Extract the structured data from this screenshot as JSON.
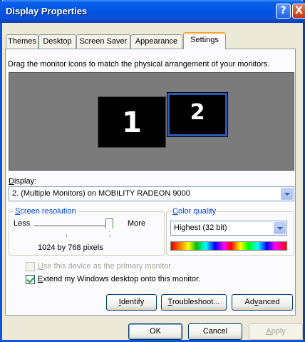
{
  "window": {
    "title": "Display Properties"
  },
  "titlebar": {
    "help_glyph": "?",
    "close_glyph": "X"
  },
  "tabs": [
    {
      "label": "Themes"
    },
    {
      "label": "Desktop"
    },
    {
      "label": "Screen Saver"
    },
    {
      "label": "Appearance"
    },
    {
      "label": "Settings"
    }
  ],
  "active_tab": "Settings",
  "settings": {
    "instruction": "Drag the monitor icons to match the physical arrangement of your monitors.",
    "monitors": [
      {
        "number": "1"
      },
      {
        "number": "2"
      }
    ],
    "display_label_pre": "",
    "display_label_ul": "D",
    "display_label_post": "isplay:",
    "display_value": "2. (Multiple Monitors) on MOBILITY RADEON 9000",
    "resolution": {
      "title_ul": "S",
      "title_post": "creen resolution",
      "less": "Less",
      "more": "More",
      "value": "1024 by 768 pixels",
      "slider_level": 1.0
    },
    "color_quality": {
      "title_ul": "C",
      "title_post": "olor quality",
      "value": "Highest (32 bit)"
    },
    "primary_checkbox": {
      "label_ul": "U",
      "label_post": "se this device as the primary monitor.",
      "checked": false,
      "enabled": false
    },
    "extend_checkbox": {
      "label_ul": "E",
      "label_post": "xtend my Windows desktop onto this monitor.",
      "checked": true,
      "enabled": true
    },
    "buttons": {
      "identify": {
        "ul": "I",
        "post": "dentify"
      },
      "troubleshoot": {
        "ul": "T",
        "post": "roubleshoot..."
      },
      "advanced": {
        "pre": "Ad",
        "ul": "v",
        "post": "anced"
      }
    }
  },
  "footer": {
    "ok": "OK",
    "cancel": "Cancel",
    "apply_ul": "A",
    "apply_post": "pply"
  },
  "colors": {
    "titlebar": "#0054e3",
    "dialog_bg": "#ece9d8",
    "group_title": "#0046d5",
    "active_tab_accent": "#f7a42a"
  }
}
